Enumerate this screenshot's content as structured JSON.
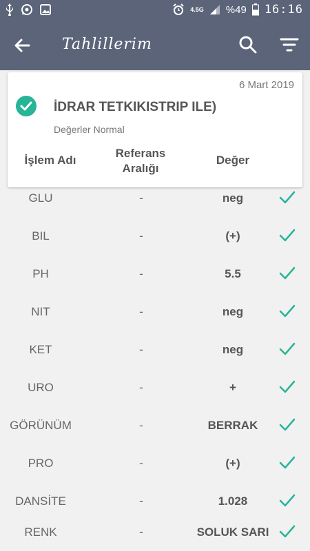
{
  "status": {
    "network": "4.5G",
    "battery": "%49",
    "time": "16:16"
  },
  "appbar": {
    "title": "Tahlillerim"
  },
  "card": {
    "date": "6 Mart 2019",
    "title": "İDRAR TETKIKISTRIP ILE)",
    "subtitle": "Değerler Normal",
    "headers": {
      "name": "İşlem Adı",
      "ref_line1": "Referans",
      "ref_line2": "Aralığı",
      "value": "Değer"
    }
  },
  "rows": [
    {
      "name": "GLU",
      "ref": "-",
      "value": "neg"
    },
    {
      "name": "BIL",
      "ref": "-",
      "value": "(+)"
    },
    {
      "name": "PH",
      "ref": "-",
      "value": "5.5"
    },
    {
      "name": "NIT",
      "ref": "-",
      "value": "neg"
    },
    {
      "name": "KET",
      "ref": "-",
      "value": "neg"
    },
    {
      "name": "URO",
      "ref": "-",
      "value": "+"
    },
    {
      "name": "GÖRÜNÜM",
      "ref": "-",
      "value": "BERRAK"
    },
    {
      "name": "PRO",
      "ref": "-",
      "value": "(+)"
    },
    {
      "name": "DANSİTE",
      "ref": "-",
      "value": "1.028"
    },
    {
      "name": "RENK",
      "ref": "-",
      "value": "SOLUK SARI"
    }
  ],
  "colors": {
    "primary": "#5b6479",
    "accent": "#26b596"
  }
}
